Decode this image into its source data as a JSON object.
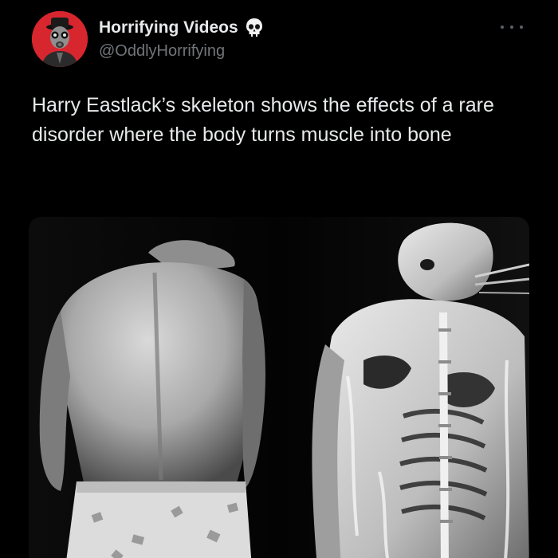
{
  "tweet": {
    "author": {
      "display_name": "Horrifying Videos",
      "handle": "@OddlyHorrifying",
      "badge_icon": "skull-icon",
      "avatar_icon": "gas-mask-figure-icon",
      "avatar_color": "#d8262f"
    },
    "menu_icon": "more-options-icon",
    "text": "Harry Eastlack’s skeleton shows the effects of a rare disorder where the body turns muscle into bone",
    "media": {
      "type": "black-and-white photo",
      "left_subject": "man-back-photo",
      "right_subject": "ossified-skeleton-photo"
    }
  },
  "colors": {
    "background": "#000000",
    "primary_text": "#e7e9ea",
    "secondary_text": "#71767b",
    "accent_red": "#d8262f"
  }
}
